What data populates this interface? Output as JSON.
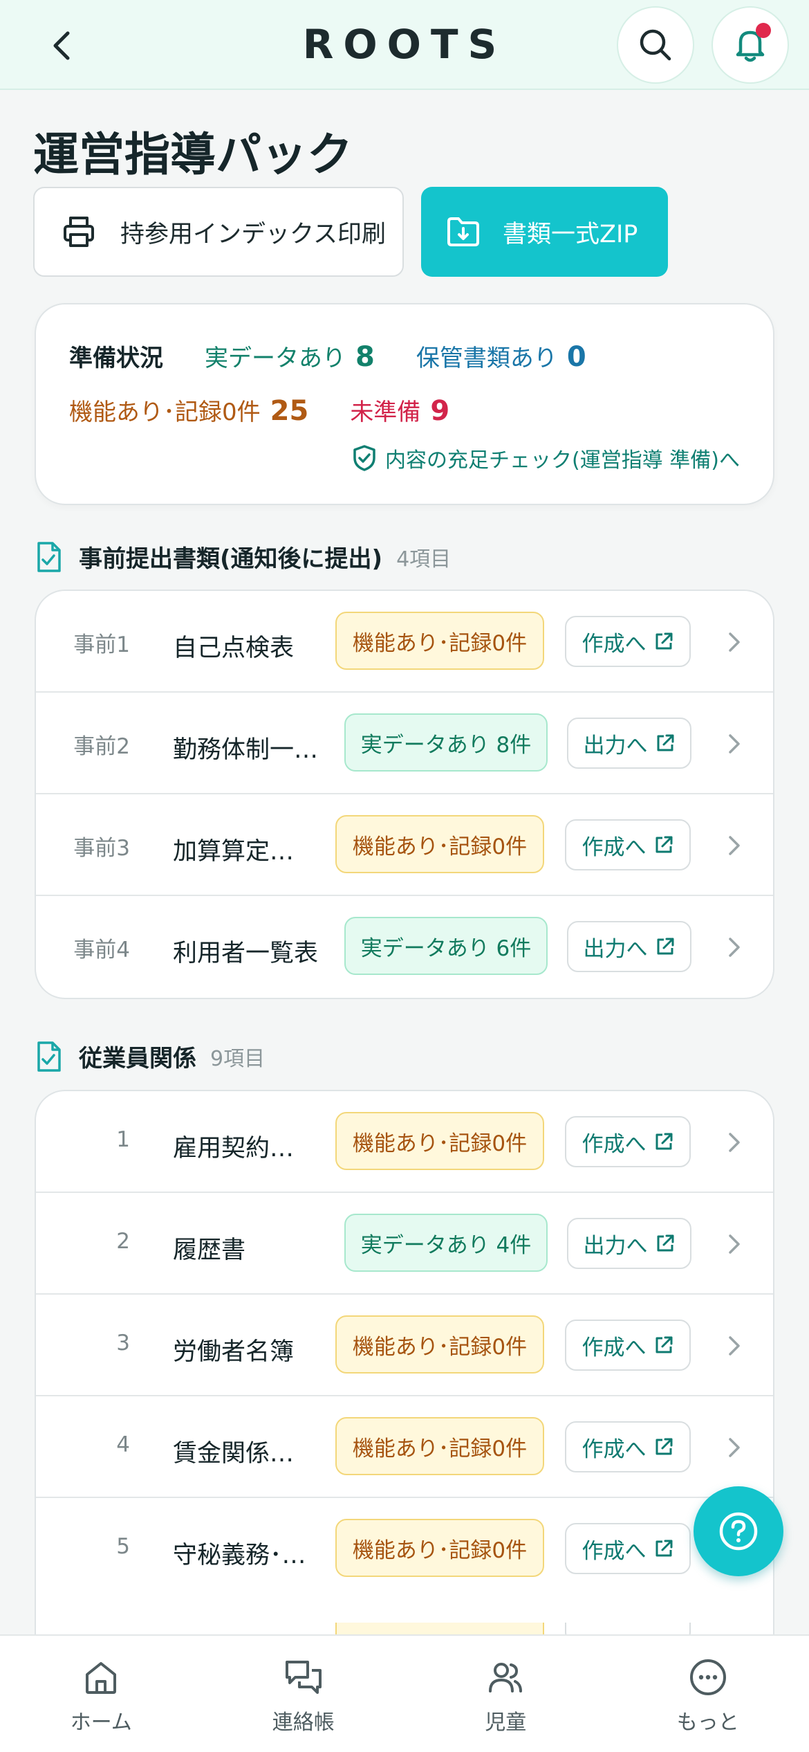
{
  "header": {
    "logo": "ROOTS"
  },
  "page": {
    "title": "運営指導パック"
  },
  "actions": {
    "print_label": "持参用インデックス印刷",
    "zip_label": "書類一式ZIP"
  },
  "status": {
    "label": "準備状況",
    "real_data_label": "実データあり",
    "real_data_count": "8",
    "stored_docs_label": "保管書類あり",
    "stored_docs_count": "0",
    "feature_zero_label": "機能あり･記録0件",
    "feature_zero_count": "25",
    "unprepared_label": "未準備",
    "unprepared_count": "9",
    "check_link": "内容の充足チェック(運営指導 準備)へ"
  },
  "sections": [
    {
      "title": "事前提出書類(通知後に提出)",
      "count": "4項目",
      "rows": [
        {
          "code": "事前1",
          "name": "自己点検表",
          "badge": "機能あり･記録0件",
          "action": "作成へ"
        },
        {
          "code": "事前2",
          "name": "勤務体制一…",
          "badge": "実データあり 8件",
          "action": "出力へ"
        },
        {
          "code": "事前3",
          "name": "加算算定…",
          "badge": "機能あり･記録0件",
          "action": "作成へ"
        },
        {
          "code": "事前4",
          "name": "利用者一覧表",
          "badge": "実データあり 6件",
          "action": "出力へ"
        }
      ]
    },
    {
      "title": "従業員関係",
      "count": "9項目",
      "rows": [
        {
          "code": "1",
          "name": "雇用契約…",
          "badge": "機能あり･記録0件",
          "action": "作成へ"
        },
        {
          "code": "2",
          "name": "履歴書",
          "badge": "実データあり 4件",
          "action": "出力へ"
        },
        {
          "code": "3",
          "name": "労働者名簿",
          "badge": "機能あり･記録0件",
          "action": "作成へ"
        },
        {
          "code": "4",
          "name": "賃金関係…",
          "badge": "機能あり･記録0件",
          "action": "作成へ"
        },
        {
          "code": "5",
          "name": "守秘義務･…",
          "badge": "機能あり･記録0件",
          "action": "作成へ"
        }
      ]
    }
  ],
  "nav": {
    "home": "ホーム",
    "notes": "連絡帳",
    "children": "児童",
    "more": "もっと"
  },
  "colors": {
    "accent": "#14c4cc",
    "green": "#12816b",
    "blue": "#1a76a8",
    "orange": "#b05a14",
    "red": "#d2244a"
  }
}
